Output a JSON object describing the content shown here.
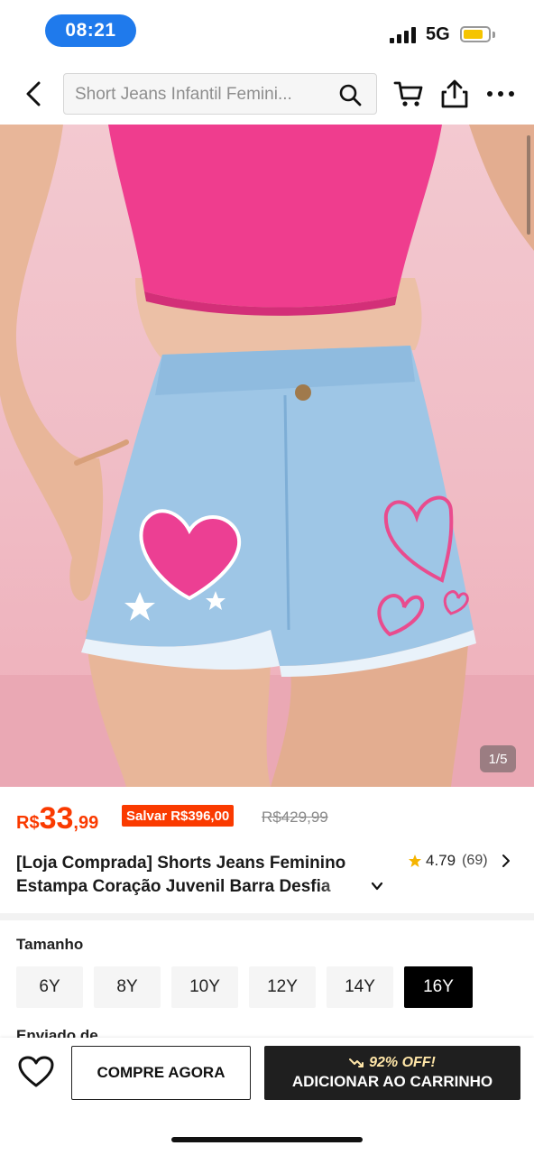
{
  "status_bar": {
    "time": "08:21",
    "network": "5G"
  },
  "search": {
    "query": "Short Jeans Infantil Femini..."
  },
  "gallery": {
    "current": "1",
    "total": "5",
    "counter_text": "1/5"
  },
  "price": {
    "currency": "R$",
    "integer": "33",
    "decimal": ",99",
    "savings_label": "Salvar R$396,00",
    "original_price": "R$429,99"
  },
  "product": {
    "title_line1": "[Loja Comprada] Shorts Jeans Feminino",
    "title_line2": "Estampa Coração Juvenil Barra Desfia",
    "rating": "4.79",
    "review_count": "(69)"
  },
  "size": {
    "label": "Tamanho",
    "options": [
      "6Y",
      "8Y",
      "10Y",
      "12Y",
      "14Y",
      "16Y"
    ],
    "selected": "16Y"
  },
  "shipping": {
    "label": "Enviado de"
  },
  "bottom_bar": {
    "buy_now": "COMPRE AGORA",
    "discount_tag": "92% OFF!",
    "add_to_cart": "ADICIONAR AO CARRINHO"
  },
  "colors": {
    "price": "#fa3a00",
    "status_time_bg": "#1f7aec",
    "selected_size_bg": "#000000",
    "add_cart_bg": "#1f1f1f",
    "rating_star": "#f5b400"
  },
  "icons": [
    "back-icon",
    "search-icon",
    "cart-icon",
    "share-icon",
    "more-icon",
    "star-icon",
    "chevron-right-icon",
    "chevron-down-icon",
    "heart-icon",
    "trend-icon"
  ]
}
